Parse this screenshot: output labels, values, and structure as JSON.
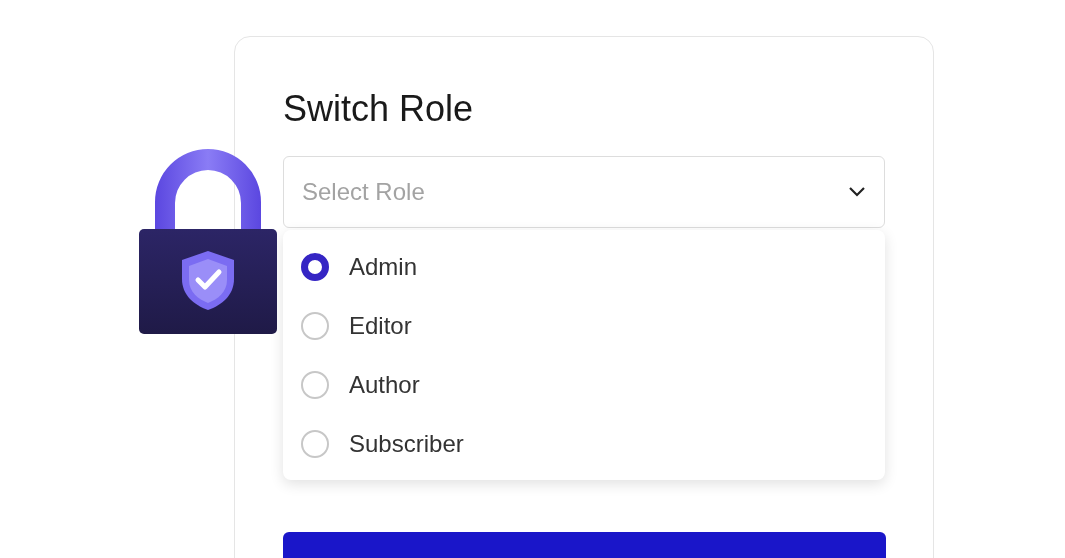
{
  "title": "Switch Role",
  "select": {
    "placeholder": "Select Role",
    "expanded": true
  },
  "options": [
    {
      "label": "Admin",
      "selected": true
    },
    {
      "label": "Editor",
      "selected": false
    },
    {
      "label": "Author",
      "selected": false
    },
    {
      "label": "Subscriber",
      "selected": false
    }
  ]
}
